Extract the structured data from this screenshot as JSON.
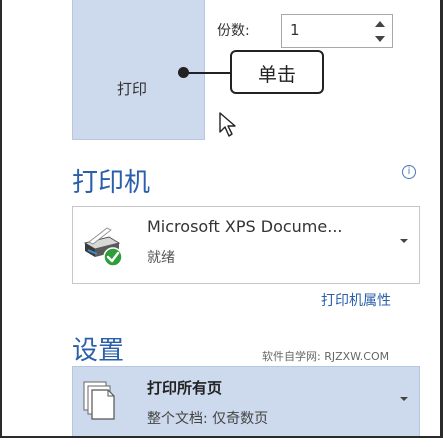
{
  "print_button": {
    "label": "打印"
  },
  "copies": {
    "label": "份数:",
    "value": "1"
  },
  "callout": {
    "text": "单击"
  },
  "printer_section": {
    "heading": "打印机",
    "info_icon": "info-icon",
    "printer_name": "Microsoft XPS Docume...",
    "printer_status": "就绪",
    "properties_link": "打印机属性"
  },
  "settings_section": {
    "heading": "设置",
    "watermark": "软件自学网: RJZXW.COM",
    "pages_title": "打印所有页",
    "pages_subtitle": "整个文档: 仅奇数页"
  },
  "colors": {
    "accent": "#2a5faa",
    "selected_bg": "#cdd9ec"
  }
}
